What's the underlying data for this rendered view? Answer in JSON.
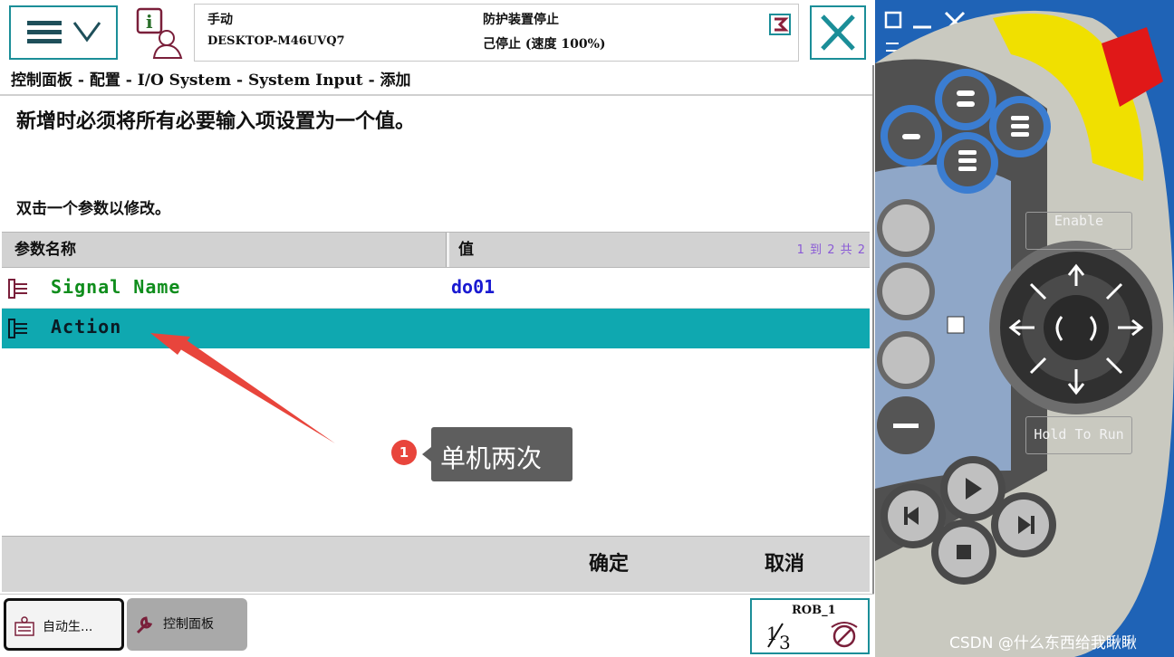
{
  "status": {
    "mode": "手动",
    "hostname": "DESKTOP-M46UVQ7",
    "guard": "防护装置停止",
    "state": "己停止 (速度 100%)"
  },
  "breadcrumb": "控制面板 - 配置 - I/O System - System Input - 添加",
  "instruction": "新增时必须将所有必要输入项设置为一个值。",
  "hint": "双击一个参数以修改。",
  "table": {
    "header_name": "参数名称",
    "header_value": "值",
    "pager": "1 到 2 共 2",
    "rows": [
      {
        "name": "Signal Name",
        "value": "do01"
      },
      {
        "name": "Action",
        "value": ""
      }
    ]
  },
  "annotation": {
    "number": "1",
    "text": "单机两次"
  },
  "actions": {
    "ok": "确定",
    "cancel": "取消"
  },
  "taskbar": {
    "task_1": "自动生...",
    "task_2": "控制面板",
    "robot": "ROB_1",
    "speed_fraction": "1/3"
  },
  "hardware": {
    "enable_label": "Enable",
    "hold_label": "Hold To Run"
  },
  "watermark": "CSDN @什么东西给我瞅瞅",
  "colors": {
    "accent": "#1b8e98",
    "selected_row": "#0fa8b0",
    "signal_name": "#0f8d1c",
    "value_text": "#1a1ad1",
    "hardware_bg": "#1f63b6"
  }
}
